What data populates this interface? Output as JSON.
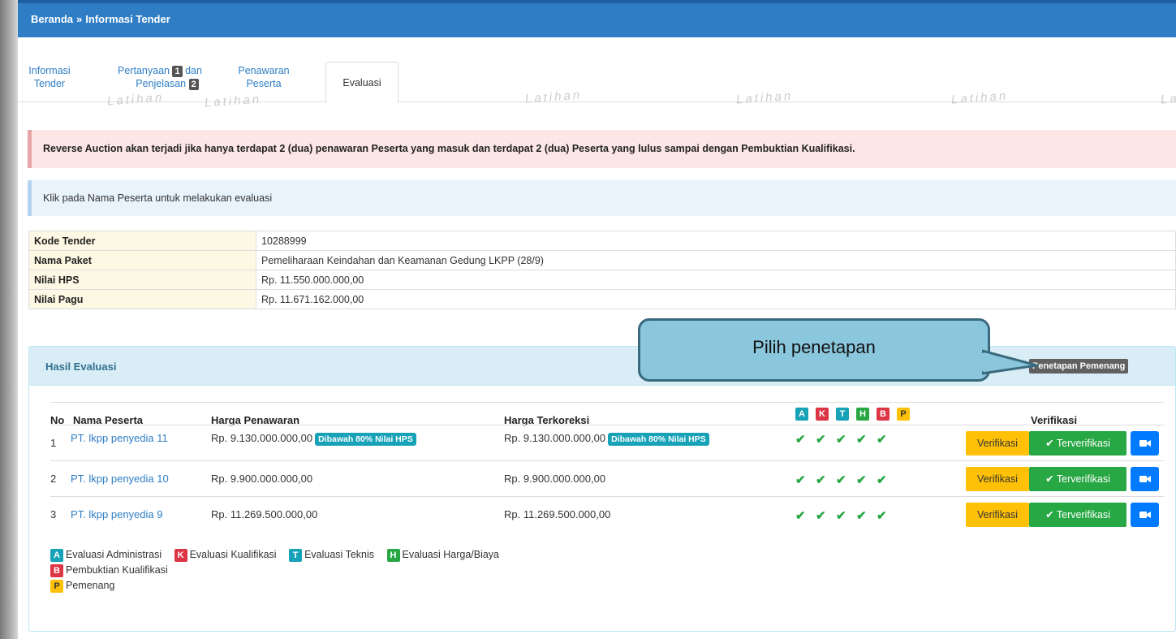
{
  "breadcrumb": {
    "home": "Beranda",
    "separator": "»",
    "current": "Informasi Tender"
  },
  "tabs": [
    {
      "line1": "Informasi",
      "line2": "Tender"
    },
    {
      "line1": "Pertanyaan",
      "badge1": "1",
      "line1b": "dan",
      "line2": "Penjelasan",
      "badge2": "2"
    },
    {
      "line1": "Penawaran",
      "line2": "Peserta"
    },
    {
      "label": "Evaluasi",
      "active": true
    }
  ],
  "watermark": "Latihan",
  "alerts": {
    "danger": "Reverse Auction akan terjadi jika hanya terdapat 2 (dua) penawaran Peserta yang masuk dan terdapat 2 (dua) Peserta yang lulus sampai dengan Pembuktian Kualifikasi.",
    "info": "Klik pada Nama Peserta untuk melakukan evaluasi"
  },
  "info_table": [
    {
      "key": "Kode Tender",
      "value": "10288999"
    },
    {
      "key": "Nama Paket",
      "value": "Pemeliharaan Keindahan dan Keamanan Gedung LKPP (28/9)"
    },
    {
      "key": "Nilai HPS",
      "value": "Rp. 11.550.000.000,00"
    },
    {
      "key": "Nilai Pagu",
      "value": "Rp. 11.671.162.000,00"
    }
  ],
  "panel": {
    "title": "Hasil Evaluasi",
    "button": "Penetapan Pemenang"
  },
  "callout": "Pilih penetapan",
  "table": {
    "headers": {
      "no": "No",
      "nama": "Nama Peserta",
      "harga": "Harga Penawaran",
      "koreksi": "Harga Terkoreksi",
      "verifikasi": "Verifikasi"
    },
    "stage_letters": [
      "A",
      "K",
      "T",
      "H",
      "B",
      "P"
    ],
    "rows": [
      {
        "no": "1",
        "nama": "PT. lkpp penyedia 11",
        "harga": "Rp. 9.130.000.000,00",
        "harga_badge": "Dibawah 80% Nilai HPS",
        "koreksi": "Rp. 9.130.000.000,00",
        "koreksi_badge": "Dibawah 80% Nilai HPS"
      },
      {
        "no": "2",
        "nama": "PT. lkpp penyedia 10",
        "harga": "Rp. 9.900.000.000,00",
        "harga_badge": "",
        "koreksi": "Rp. 9.900.000.000,00",
        "koreksi_badge": ""
      },
      {
        "no": "3",
        "nama": "PT. lkpp penyedia 9",
        "harga": "Rp. 11.269.500.000,00",
        "harga_badge": "",
        "koreksi": "Rp. 11.269.500.000,00",
        "koreksi_badge": ""
      }
    ],
    "buttons": {
      "verif": "Verifikasi",
      "done": "✔ Terverifikasi",
      "video_icon": "video-camera-icon"
    },
    "check_glyph": "✔"
  },
  "legend": [
    {
      "letter": "A",
      "label": "Evaluasi Administrasi"
    },
    {
      "letter": "K",
      "label": "Evaluasi Kualifikasi"
    },
    {
      "letter": "T",
      "label": "Evaluasi Teknis"
    },
    {
      "letter": "H",
      "label": "Evaluasi Harga/Biaya"
    },
    {
      "letter": "B",
      "label": "Pembuktian Kualifikasi"
    },
    {
      "letter": "P",
      "label": "Pemenang"
    }
  ]
}
